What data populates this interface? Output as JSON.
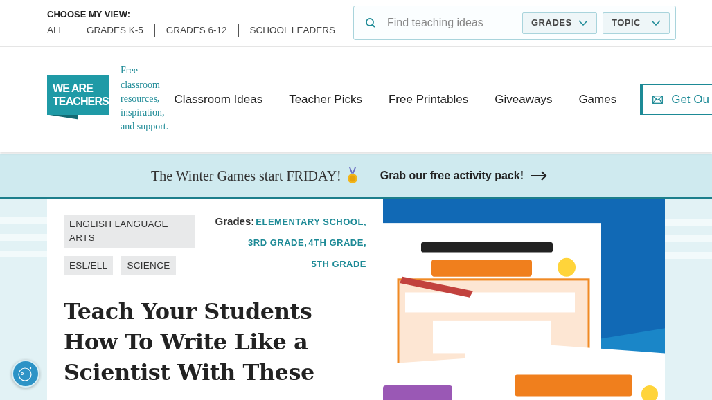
{
  "view_selector": {
    "label": "CHOOSE MY VIEW:",
    "options": [
      "ALL",
      "GRADES K-5",
      "GRADES 6-12",
      "SCHOOL LEADERS"
    ]
  },
  "search": {
    "placeholder": "Find teaching ideas",
    "filters": [
      "GRADES",
      "TOPIC"
    ]
  },
  "logo": {
    "lines": [
      "WE ARE",
      "TEACHERS"
    ]
  },
  "tagline": "Free classroom resources, inspiration, and support.",
  "nav": {
    "items": [
      "Classroom Ideas",
      "Teacher Picks",
      "Free Printables",
      "Giveaways",
      "Games"
    ],
    "cta": "Get Ou"
  },
  "banner": {
    "text": "The Winter Games start FRIDAY!",
    "link": "Grab our free activity pack!"
  },
  "article": {
    "tags": [
      "ENGLISH LANGUAGE ARTS",
      "ESL/ELL",
      "SCIENCE"
    ],
    "grades_label": "Grades:",
    "grades": [
      "ELEMENTARY SCHOOL,",
      "3RD GRADE,",
      "4TH GRADE,",
      "5TH GRADE"
    ],
    "title": "Teach Your Students How To Write Like a Scientist With These"
  }
}
